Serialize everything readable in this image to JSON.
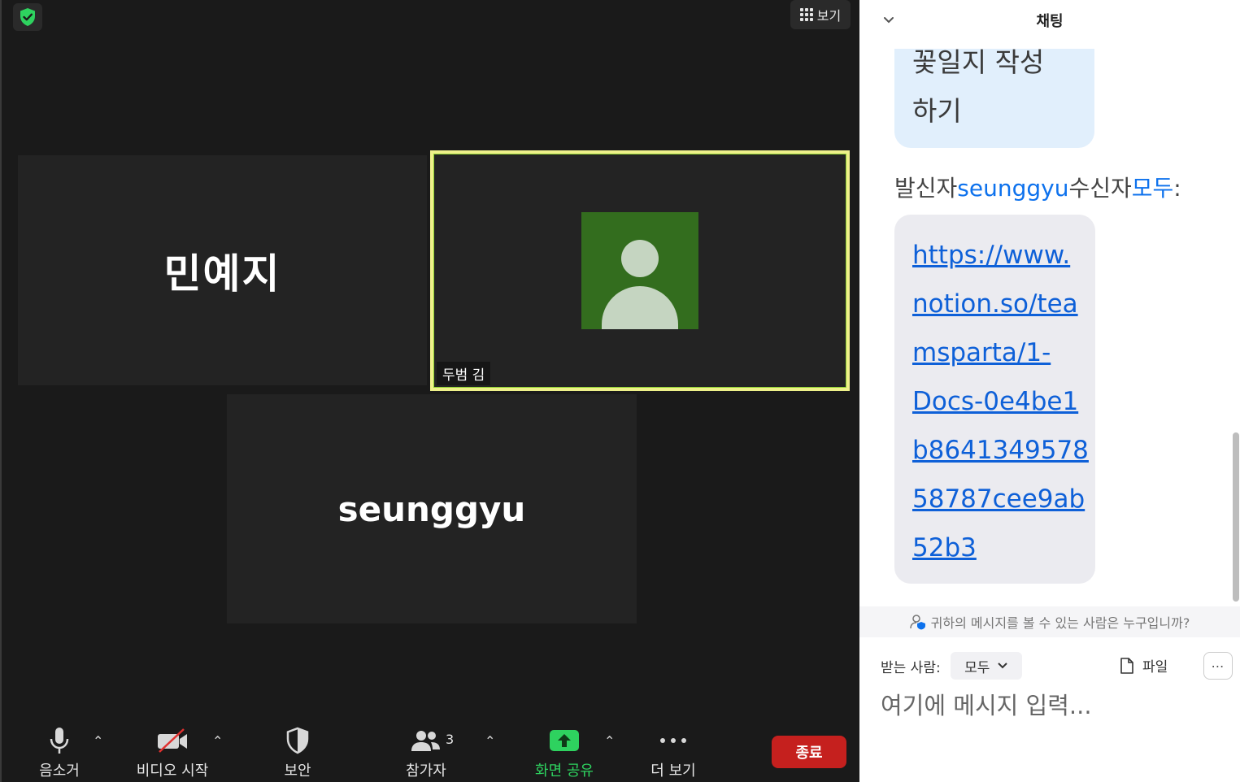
{
  "video": {
    "view_label": "보기",
    "tiles": [
      {
        "name": "민예지"
      },
      {
        "name": "두범 김"
      },
      {
        "name": "seunggyu"
      }
    ]
  },
  "toolbar": {
    "mute_label": "음소거",
    "video_label": "비디오 시작",
    "security_label": "보안",
    "participants_label": "참가자",
    "participants_count": "3",
    "share_label": "화면 공유",
    "more_label": "더 보기",
    "end_label": "종료"
  },
  "chat": {
    "title": "채팅",
    "messages": [
      {
        "text_lines": [
          "꽃일지 작성",
          "하기"
        ]
      },
      {
        "sender_prefix": "발신자",
        "sender": "seunggyu",
        "recipient_prefix": "수신자",
        "recipient": "모두",
        "suffix": ":",
        "link_lines": [
          "https://www.",
          "notion.so/tea",
          "msparta/1-",
          "Docs-0e4be1",
          "b8641349578",
          "58787cee9ab",
          "52b3"
        ]
      }
    ],
    "visibility_hint": "귀하의 메시지를 볼 수 있는 사람은 누구입니까?",
    "to_label": "받는 사람:",
    "to_value": "모두",
    "file_label": "파일",
    "input_placeholder": "여기에 메시지 입력..."
  },
  "colors": {
    "end_button": "#c5201e",
    "share_green": "#2ed25f",
    "active_speaker_border": "#eef08a",
    "avatar_bg": "#336d1e",
    "link_blue": "#0e60d8"
  }
}
